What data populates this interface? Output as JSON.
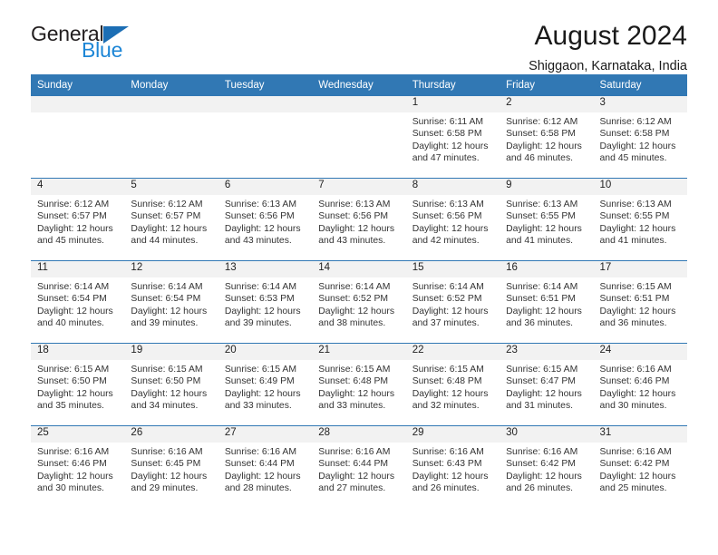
{
  "brand": {
    "word1": "General",
    "word2": "Blue",
    "triangle_color": "#1c6eb4",
    "blue_color": "#1d86d6"
  },
  "header": {
    "title": "August 2024",
    "location": "Shiggaon, Karnataka, India"
  },
  "theme": {
    "header_bg": "#3178b4",
    "header_text": "#ffffff",
    "daynum_band_bg": "#f2f2f2",
    "row_divider": "#3178b4"
  },
  "weekday_headers": [
    "Sunday",
    "Monday",
    "Tuesday",
    "Wednesday",
    "Thursday",
    "Friday",
    "Saturday"
  ],
  "weeks": [
    [
      {
        "day": "",
        "empty": true,
        "sunrise": "",
        "sunset": "",
        "daylight_l1": "",
        "daylight_l2": ""
      },
      {
        "day": "",
        "empty": true,
        "sunrise": "",
        "sunset": "",
        "daylight_l1": "",
        "daylight_l2": ""
      },
      {
        "day": "",
        "empty": true,
        "sunrise": "",
        "sunset": "",
        "daylight_l1": "",
        "daylight_l2": ""
      },
      {
        "day": "",
        "empty": true,
        "sunrise": "",
        "sunset": "",
        "daylight_l1": "",
        "daylight_l2": ""
      },
      {
        "day": "1",
        "empty": false,
        "sunrise": "Sunrise: 6:11 AM",
        "sunset": "Sunset: 6:58 PM",
        "daylight_l1": "Daylight: 12 hours",
        "daylight_l2": "and 47 minutes."
      },
      {
        "day": "2",
        "empty": false,
        "sunrise": "Sunrise: 6:12 AM",
        "sunset": "Sunset: 6:58 PM",
        "daylight_l1": "Daylight: 12 hours",
        "daylight_l2": "and 46 minutes."
      },
      {
        "day": "3",
        "empty": false,
        "sunrise": "Sunrise: 6:12 AM",
        "sunset": "Sunset: 6:58 PM",
        "daylight_l1": "Daylight: 12 hours",
        "daylight_l2": "and 45 minutes."
      }
    ],
    [
      {
        "day": "4",
        "empty": false,
        "sunrise": "Sunrise: 6:12 AM",
        "sunset": "Sunset: 6:57 PM",
        "daylight_l1": "Daylight: 12 hours",
        "daylight_l2": "and 45 minutes."
      },
      {
        "day": "5",
        "empty": false,
        "sunrise": "Sunrise: 6:12 AM",
        "sunset": "Sunset: 6:57 PM",
        "daylight_l1": "Daylight: 12 hours",
        "daylight_l2": "and 44 minutes."
      },
      {
        "day": "6",
        "empty": false,
        "sunrise": "Sunrise: 6:13 AM",
        "sunset": "Sunset: 6:56 PM",
        "daylight_l1": "Daylight: 12 hours",
        "daylight_l2": "and 43 minutes."
      },
      {
        "day": "7",
        "empty": false,
        "sunrise": "Sunrise: 6:13 AM",
        "sunset": "Sunset: 6:56 PM",
        "daylight_l1": "Daylight: 12 hours",
        "daylight_l2": "and 43 minutes."
      },
      {
        "day": "8",
        "empty": false,
        "sunrise": "Sunrise: 6:13 AM",
        "sunset": "Sunset: 6:56 PM",
        "daylight_l1": "Daylight: 12 hours",
        "daylight_l2": "and 42 minutes."
      },
      {
        "day": "9",
        "empty": false,
        "sunrise": "Sunrise: 6:13 AM",
        "sunset": "Sunset: 6:55 PM",
        "daylight_l1": "Daylight: 12 hours",
        "daylight_l2": "and 41 minutes."
      },
      {
        "day": "10",
        "empty": false,
        "sunrise": "Sunrise: 6:13 AM",
        "sunset": "Sunset: 6:55 PM",
        "daylight_l1": "Daylight: 12 hours",
        "daylight_l2": "and 41 minutes."
      }
    ],
    [
      {
        "day": "11",
        "empty": false,
        "sunrise": "Sunrise: 6:14 AM",
        "sunset": "Sunset: 6:54 PM",
        "daylight_l1": "Daylight: 12 hours",
        "daylight_l2": "and 40 minutes."
      },
      {
        "day": "12",
        "empty": false,
        "sunrise": "Sunrise: 6:14 AM",
        "sunset": "Sunset: 6:54 PM",
        "daylight_l1": "Daylight: 12 hours",
        "daylight_l2": "and 39 minutes."
      },
      {
        "day": "13",
        "empty": false,
        "sunrise": "Sunrise: 6:14 AM",
        "sunset": "Sunset: 6:53 PM",
        "daylight_l1": "Daylight: 12 hours",
        "daylight_l2": "and 39 minutes."
      },
      {
        "day": "14",
        "empty": false,
        "sunrise": "Sunrise: 6:14 AM",
        "sunset": "Sunset: 6:52 PM",
        "daylight_l1": "Daylight: 12 hours",
        "daylight_l2": "and 38 minutes."
      },
      {
        "day": "15",
        "empty": false,
        "sunrise": "Sunrise: 6:14 AM",
        "sunset": "Sunset: 6:52 PM",
        "daylight_l1": "Daylight: 12 hours",
        "daylight_l2": "and 37 minutes."
      },
      {
        "day": "16",
        "empty": false,
        "sunrise": "Sunrise: 6:14 AM",
        "sunset": "Sunset: 6:51 PM",
        "daylight_l1": "Daylight: 12 hours",
        "daylight_l2": "and 36 minutes."
      },
      {
        "day": "17",
        "empty": false,
        "sunrise": "Sunrise: 6:15 AM",
        "sunset": "Sunset: 6:51 PM",
        "daylight_l1": "Daylight: 12 hours",
        "daylight_l2": "and 36 minutes."
      }
    ],
    [
      {
        "day": "18",
        "empty": false,
        "sunrise": "Sunrise: 6:15 AM",
        "sunset": "Sunset: 6:50 PM",
        "daylight_l1": "Daylight: 12 hours",
        "daylight_l2": "and 35 minutes."
      },
      {
        "day": "19",
        "empty": false,
        "sunrise": "Sunrise: 6:15 AM",
        "sunset": "Sunset: 6:50 PM",
        "daylight_l1": "Daylight: 12 hours",
        "daylight_l2": "and 34 minutes."
      },
      {
        "day": "20",
        "empty": false,
        "sunrise": "Sunrise: 6:15 AM",
        "sunset": "Sunset: 6:49 PM",
        "daylight_l1": "Daylight: 12 hours",
        "daylight_l2": "and 33 minutes."
      },
      {
        "day": "21",
        "empty": false,
        "sunrise": "Sunrise: 6:15 AM",
        "sunset": "Sunset: 6:48 PM",
        "daylight_l1": "Daylight: 12 hours",
        "daylight_l2": "and 33 minutes."
      },
      {
        "day": "22",
        "empty": false,
        "sunrise": "Sunrise: 6:15 AM",
        "sunset": "Sunset: 6:48 PM",
        "daylight_l1": "Daylight: 12 hours",
        "daylight_l2": "and 32 minutes."
      },
      {
        "day": "23",
        "empty": false,
        "sunrise": "Sunrise: 6:15 AM",
        "sunset": "Sunset: 6:47 PM",
        "daylight_l1": "Daylight: 12 hours",
        "daylight_l2": "and 31 minutes."
      },
      {
        "day": "24",
        "empty": false,
        "sunrise": "Sunrise: 6:16 AM",
        "sunset": "Sunset: 6:46 PM",
        "daylight_l1": "Daylight: 12 hours",
        "daylight_l2": "and 30 minutes."
      }
    ],
    [
      {
        "day": "25",
        "empty": false,
        "sunrise": "Sunrise: 6:16 AM",
        "sunset": "Sunset: 6:46 PM",
        "daylight_l1": "Daylight: 12 hours",
        "daylight_l2": "and 30 minutes."
      },
      {
        "day": "26",
        "empty": false,
        "sunrise": "Sunrise: 6:16 AM",
        "sunset": "Sunset: 6:45 PM",
        "daylight_l1": "Daylight: 12 hours",
        "daylight_l2": "and 29 minutes."
      },
      {
        "day": "27",
        "empty": false,
        "sunrise": "Sunrise: 6:16 AM",
        "sunset": "Sunset: 6:44 PM",
        "daylight_l1": "Daylight: 12 hours",
        "daylight_l2": "and 28 minutes."
      },
      {
        "day": "28",
        "empty": false,
        "sunrise": "Sunrise: 6:16 AM",
        "sunset": "Sunset: 6:44 PM",
        "daylight_l1": "Daylight: 12 hours",
        "daylight_l2": "and 27 minutes."
      },
      {
        "day": "29",
        "empty": false,
        "sunrise": "Sunrise: 6:16 AM",
        "sunset": "Sunset: 6:43 PM",
        "daylight_l1": "Daylight: 12 hours",
        "daylight_l2": "and 26 minutes."
      },
      {
        "day": "30",
        "empty": false,
        "sunrise": "Sunrise: 6:16 AM",
        "sunset": "Sunset: 6:42 PM",
        "daylight_l1": "Daylight: 12 hours",
        "daylight_l2": "and 26 minutes."
      },
      {
        "day": "31",
        "empty": false,
        "sunrise": "Sunrise: 6:16 AM",
        "sunset": "Sunset: 6:42 PM",
        "daylight_l1": "Daylight: 12 hours",
        "daylight_l2": "and 25 minutes."
      }
    ]
  ]
}
